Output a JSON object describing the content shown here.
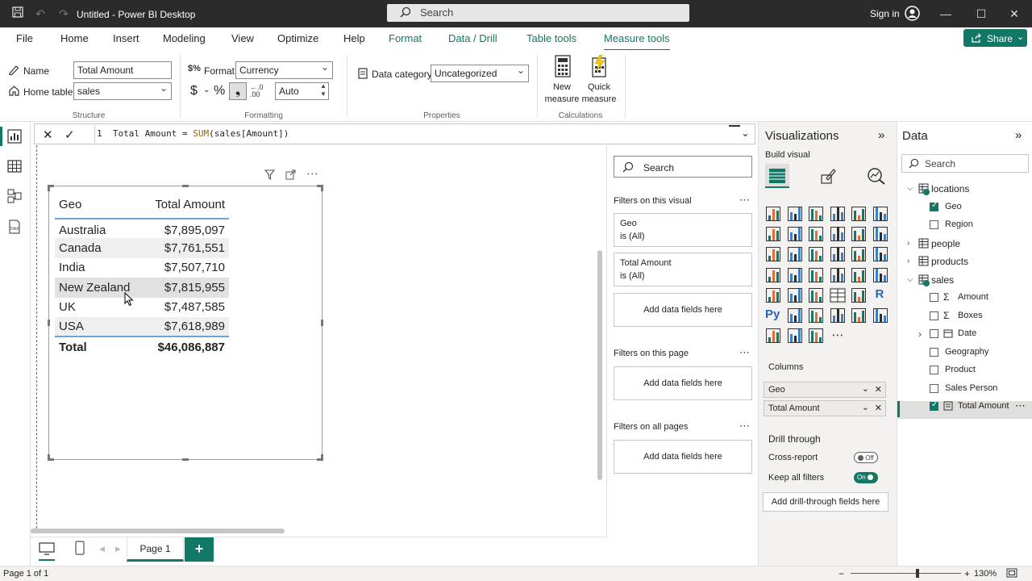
{
  "titlebar": {
    "title": "Untitled - Power BI Desktop",
    "search_placeholder": "Search",
    "sign_in": "Sign in"
  },
  "tabs": [
    "File",
    "Home",
    "Insert",
    "Modeling",
    "View",
    "Optimize",
    "Help",
    "Format",
    "Data / Drill",
    "Table tools",
    "Measure tools"
  ],
  "active_tab": "Measure tools",
  "share_label": "Share",
  "ribbon": {
    "structure": {
      "name_label": "Name",
      "name_value": "Total Amount",
      "home_table_label": "Home table",
      "home_table_value": "sales",
      "group": "Structure"
    },
    "formatting": {
      "format_label": "Format",
      "format_value": "Currency",
      "dollar": "$",
      "percent": "%",
      "comma": "❟",
      "decimals_value": "Auto",
      "group": "Formatting"
    },
    "properties": {
      "data_category_label": "Data category",
      "data_category_value": "Uncategorized",
      "group": "Properties"
    },
    "calculations": {
      "new_measure": [
        "New",
        "measure"
      ],
      "quick_measure": [
        "Quick",
        "measure"
      ],
      "group": "Calculations"
    }
  },
  "formula": {
    "line_no": "1",
    "text_before": "Total Amount = ",
    "fn": "SUM",
    "text_after": "(sales[Amount])"
  },
  "matrix": {
    "headers": [
      "Geo",
      "Total Amount"
    ],
    "rows": [
      {
        "geo": "Australia",
        "amount": "$7,895,097"
      },
      {
        "geo": "Canada",
        "amount": "$7,761,551"
      },
      {
        "geo": "India",
        "amount": "$7,507,710"
      },
      {
        "geo": "New Zealand",
        "amount": "$7,815,955"
      },
      {
        "geo": "UK",
        "amount": "$7,487,585"
      },
      {
        "geo": "USA",
        "amount": "$7,618,989"
      }
    ],
    "total_label": "Total",
    "total_value": "$46,086,887"
  },
  "filters": {
    "search_placeholder": "Search",
    "on_visual": "Filters on this visual",
    "geo_filter": {
      "name": "Geo",
      "state": "is (All)"
    },
    "amount_filter": {
      "name": "Total Amount",
      "state": "is (All)"
    },
    "add_fields": "Add data fields here",
    "on_page": "Filters on this page",
    "on_all_pages": "Filters on all pages"
  },
  "viz": {
    "title": "Visualizations",
    "build_visual": "Build visual",
    "columns_label": "Columns",
    "columns": [
      "Geo",
      "Total Amount"
    ],
    "drill_through": "Drill through",
    "cross_report": "Cross-report",
    "cross_report_state": "Off",
    "keep_all_filters": "Keep all filters",
    "keep_all_filters_state": "On",
    "add_drill": "Add drill-through fields here",
    "py_label": "Py",
    "r_label": "R"
  },
  "data": {
    "title": "Data",
    "search_placeholder": "Search",
    "tree": [
      {
        "label": "locations",
        "level": 0,
        "kind": "table",
        "expanded": true
      },
      {
        "label": "Geo",
        "level": 1,
        "checked": true
      },
      {
        "label": "Region",
        "level": 1,
        "checked": false
      },
      {
        "label": "people",
        "level": 0,
        "kind": "table",
        "expanded": false
      },
      {
        "label": "products",
        "level": 0,
        "kind": "table",
        "expanded": false
      },
      {
        "label": "sales",
        "level": 0,
        "kind": "table",
        "expanded": true
      },
      {
        "label": "Amount",
        "level": 1,
        "checked": false,
        "sigma": true
      },
      {
        "label": "Boxes",
        "level": 1,
        "checked": false,
        "sigma": true
      },
      {
        "label": "Date",
        "level": 1,
        "checked": false,
        "date": true
      },
      {
        "label": "Geography",
        "level": 1,
        "checked": false
      },
      {
        "label": "Product",
        "level": 1,
        "checked": false
      },
      {
        "label": "Sales Person",
        "level": 1,
        "checked": false
      },
      {
        "label": "Total Amount",
        "level": 1,
        "checked": true,
        "measure": true
      }
    ]
  },
  "pages": {
    "tab": "Page 1",
    "add": "+"
  },
  "status": {
    "page": "Page 1 of 1",
    "zoom": "130%"
  }
}
